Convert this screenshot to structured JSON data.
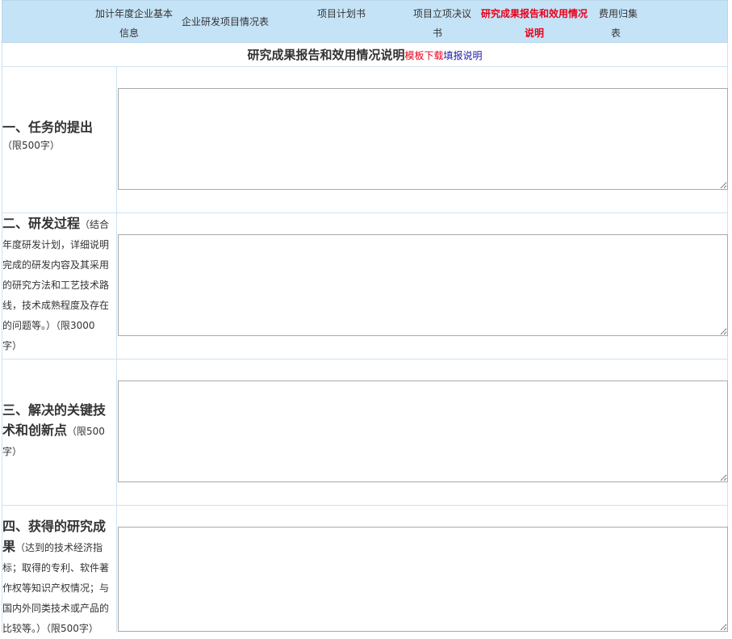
{
  "tabs": [
    {
      "line1": "加计年度企业基本",
      "line2": "信息"
    },
    {
      "line1": "企业研发项目情况表",
      "line2": ""
    },
    {
      "line1": "项目计划书",
      "line2": ""
    },
    {
      "line1": "项目立项决议",
      "line2": "书"
    },
    {
      "line1": "研究成果报告和效用情况",
      "line2": "说明"
    },
    {
      "line1": "费用归集",
      "line2": "表"
    }
  ],
  "active_tab": 4,
  "page": {
    "title": "研究成果报告和效用情况说明",
    "template_link": "模板下载",
    "guide_link": "填报说明"
  },
  "sections": [
    {
      "heading": "一、任务的提出",
      "note_lines": [
        "（限500字）"
      ],
      "value": ""
    },
    {
      "heading": "二、研发过程",
      "note_lines": [
        "（结合",
        "年度研发计划，详细说明",
        "完成的研发内容及其采用",
        "的研究方法和工艺技术路",
        "线，技术成熟程度及存在",
        "的问题等。）（限3000",
        "字）"
      ],
      "value": ""
    },
    {
      "heading": "三、解决的关键技",
      "heading2": "术和创新点",
      "note_lines": [
        "（限500",
        "字）"
      ],
      "value": ""
    },
    {
      "heading": "四、获得的研究成",
      "heading2": "果",
      "note_lines": [
        "（达到的技术经济指",
        "标；取得的专利、软件著",
        "作权等知识产权情况；与",
        "国内外同类技术或产品的",
        "比较等。）（限500字）"
      ],
      "value": ""
    }
  ]
}
